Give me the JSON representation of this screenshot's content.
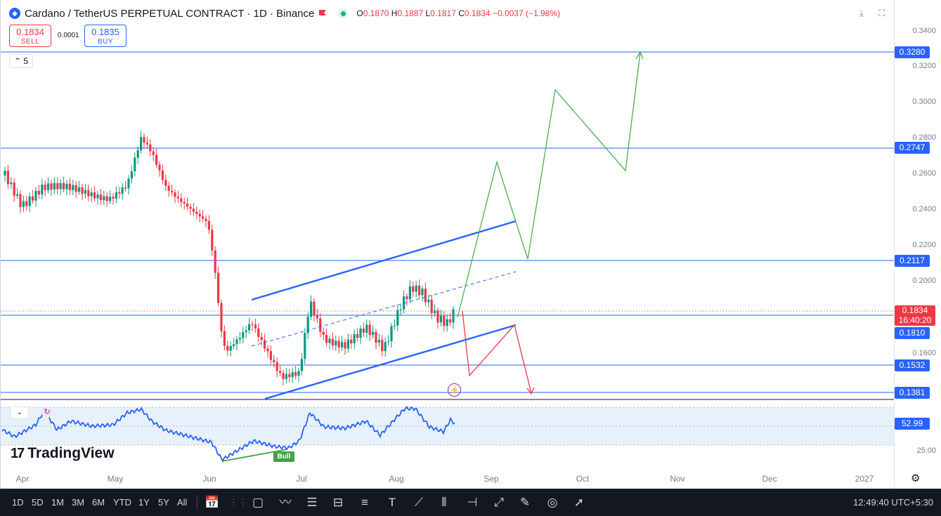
{
  "header": {
    "symbol_title": "Cardano / TetherUS PERPETUAL CONTRACT · 1D · Binance",
    "ohlc": {
      "open_label": "O",
      "open": "0.1870",
      "high_label": "H",
      "high": "0.1887",
      "low_label": "L",
      "low": "0.1817",
      "close_label": "C",
      "close": "0.1834",
      "change": "−0.0037 (−1.98%)"
    }
  },
  "trade": {
    "sell_price": "0.1834",
    "sell_label": "SELL",
    "spread": "0.0001",
    "buy_price": "0.1835",
    "buy_label": "BUY"
  },
  "indicator_collapse_label": "5",
  "price_scale": {
    "ticks": [
      "0.3400",
      "0.3200",
      "0.3000",
      "0.2800",
      "0.2600",
      "0.2400",
      "0.2200",
      "0.2000",
      "0.1600"
    ],
    "levels": [
      "0.3280",
      "0.2747",
      "0.2117",
      "0.1810",
      "0.1532",
      "0.1381"
    ],
    "current_price": "0.1834",
    "countdown": "16:40:20",
    "rsi_value": "52.99",
    "rsi_tick": "25.00"
  },
  "rsi_pane": {
    "divergence_label": "Bull"
  },
  "time_axis": [
    "Apr",
    "May",
    "Jun",
    "Jul",
    "Aug",
    "Sep",
    "Oct",
    "Nov",
    "Dec",
    "2027"
  ],
  "branding": {
    "logo_text": "TradingView",
    "logo_mark": "17"
  },
  "toolbar": {
    "ranges": [
      "1D",
      "5D",
      "1M",
      "3M",
      "6M",
      "YTD",
      "1Y",
      "5Y",
      "All"
    ],
    "clock": "12:49:40 UTC+5:30"
  },
  "colors": {
    "level_line": "#2962ff",
    "bull_candle": "#089981",
    "bear_candle": "#f23645",
    "projection_up": "#4caf50",
    "projection_down": "#f23645",
    "rsi_line": "#2962ff"
  }
}
